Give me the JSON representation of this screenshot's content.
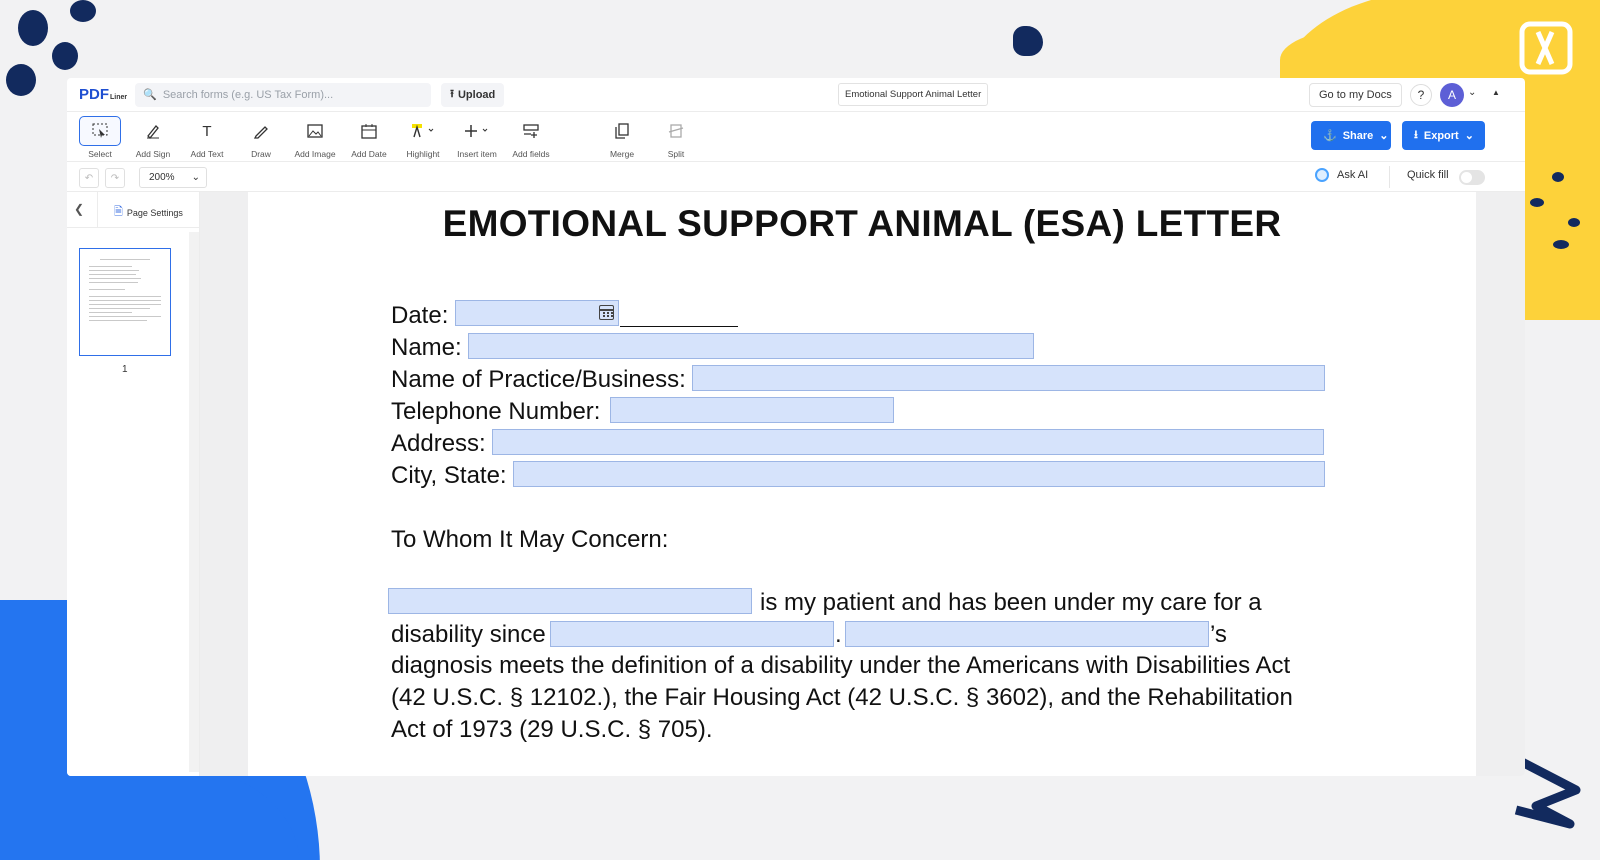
{
  "app": {
    "logo": {
      "pdf": "PDF",
      "liner": "Liner"
    },
    "search_placeholder": "Search forms (e.g. US Tax Form)...",
    "upload_label": "Upload",
    "document_title": "Emotional Support Animal Letter",
    "go_to_docs": "Go to my Docs",
    "help": "?",
    "avatar_initial": "A"
  },
  "toolbar": {
    "tools": [
      "Select",
      "Add Sign",
      "Add Text",
      "Draw",
      "Add Image",
      "Add Date",
      "Highlight",
      "Insert item",
      "Add fields",
      "Merge",
      "Split"
    ],
    "share_label": "Share",
    "export_label": "Export"
  },
  "subbar": {
    "zoom": "200%",
    "ask_ai": "Ask AI",
    "quick_fill": "Quick fill",
    "quick_fill_on": false
  },
  "sidebar": {
    "page_settings": "Page Settings",
    "page_number": "1"
  },
  "document": {
    "title": "EMOTIONAL SUPPORT ANIMAL (ESA) LETTER",
    "labels": {
      "date": "Date:",
      "name": "Name:",
      "practice": "Name of Practice/Business:",
      "telephone": "Telephone Number:",
      "address": "Address:",
      "city_state": "City, State:"
    },
    "salutation": "To Whom It May Concern:",
    "body": {
      "line1_after": "is my patient and has been under my care for a",
      "line2_before": "disability since",
      "line2_period": ".",
      "line2_after": "’s",
      "line3": "diagnosis meets the definition of a disability under the Americans with Disabilities Act",
      "line4": "(42 U.S.C. § 12102.), the Fair Housing Act (42 U.S.C. § 3602), and the Rehabilitation",
      "line5": "Act of 1973 (29 U.S.C. § 705)."
    },
    "field_values": {
      "date": "",
      "name": "",
      "practice": "",
      "telephone": "",
      "address": "",
      "city_state": "",
      "patient_name": "",
      "since_date": "",
      "patient_name_possessive": ""
    }
  },
  "colors": {
    "accent": "#2070ee",
    "field_fill": "#d6e3fb",
    "deco_yellow": "#fdd23a",
    "deco_blue": "#2475f0",
    "deco_navy": "#122a5e"
  }
}
